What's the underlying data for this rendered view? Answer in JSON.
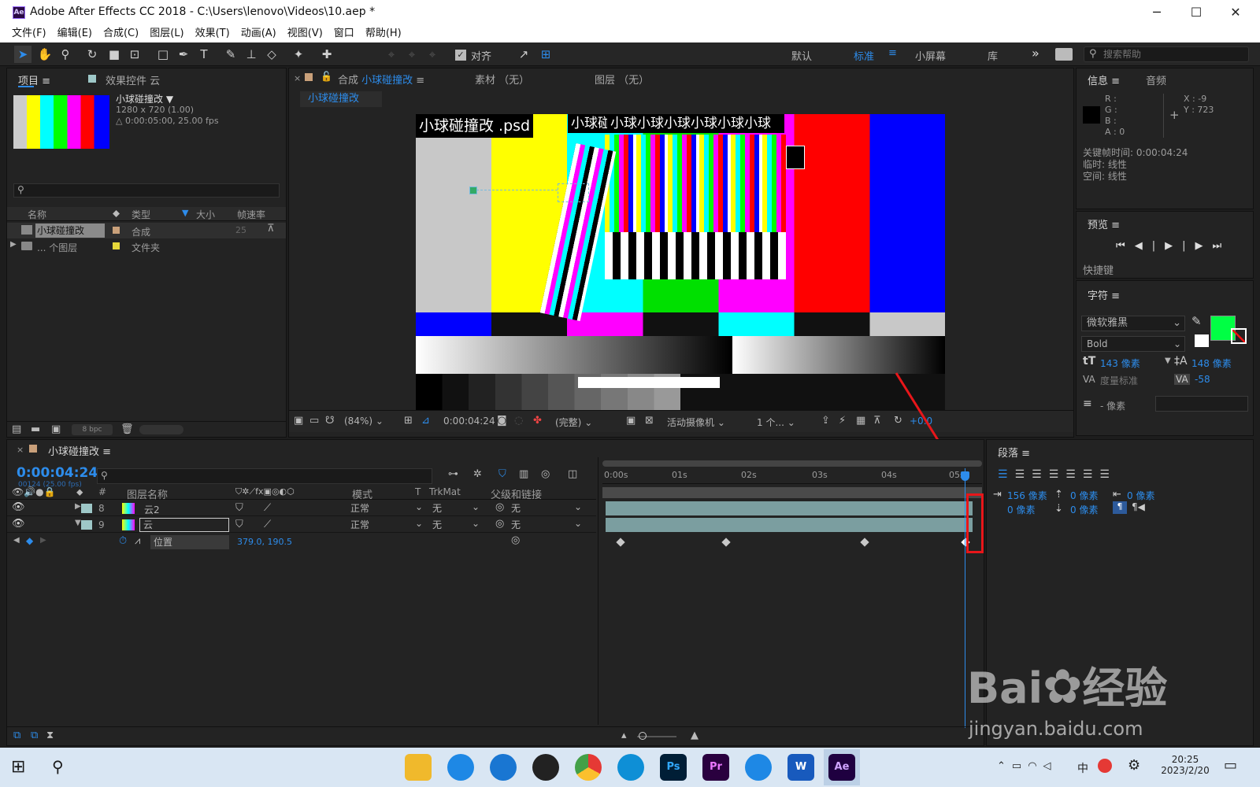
{
  "window": {
    "title": "Adobe After Effects CC 2018 - C:\\Users\\lenovo\\Videos\\10.aep *",
    "logo": "Ae",
    "minimize": "─",
    "maximize": "☐",
    "close": "✕"
  },
  "menu": [
    "文件(F)",
    "编辑(E)",
    "合成(C)",
    "图层(L)",
    "效果(T)",
    "动画(A)",
    "视图(V)",
    "窗口",
    "帮助(H)"
  ],
  "toolbar": {
    "align_label": "对齐",
    "workspaces": [
      "默认",
      "标准",
      "小屏幕",
      "库"
    ],
    "active_workspace": "标准",
    "more": "»",
    "search_placeholder": "搜索帮助"
  },
  "project": {
    "tabs": [
      "项目",
      "效果控件 云"
    ],
    "item_name": "小球碰撞改 ▼",
    "item_res": "1280 x 720 (1.00)",
    "item_dur": "△ 0:00:05:00, 25.00 fps",
    "search_placeholder": "",
    "columns": [
      "名称",
      "类型",
      "大小",
      "帧速率"
    ],
    "rows": [
      {
        "name": "小球碰撞改",
        "type": "合成",
        "fps": "25"
      },
      {
        "name": "... 个图层",
        "type": "文件夹",
        "fps": ""
      }
    ],
    "bpc": "8 bpc"
  },
  "comp": {
    "tab_prefix": "合成",
    "tab_name": "小球碰撞改",
    "footage_tab": "素材 （无）",
    "layer_tab": "图层 （无）",
    "breadcrumb": "小球碰撞改",
    "overlay1": "小球碰撞改 .psd",
    "overlay2": "小球碰撞改",
    "banner": "小球小球小球小球小球小球",
    "zoom": "(84%)",
    "timecode": "0:00:04:24",
    "quality": "(完整)",
    "camera": "活动摄像机",
    "views": "1 个...",
    "exposure": "+0.0"
  },
  "info": {
    "tabs": [
      "信息",
      "音频"
    ],
    "r": "R :",
    "g": "G :",
    "b": "B :",
    "a": "A : 0",
    "x": "X : -9",
    "y": "Y : 723",
    "kf_time": "关键帧时间: 0:00:04:24",
    "temporal": "临时: 线性",
    "spatial": "空间: 线性"
  },
  "preview": {
    "title": "预览",
    "controls": [
      "⏮",
      "◀|",
      "▶",
      "|▶",
      "⏭"
    ],
    "shortcut": "快捷键"
  },
  "character": {
    "title": "字符",
    "font": "微软雅黑",
    "style": "Bold",
    "size": "143 像素",
    "leading": "148 像素",
    "kerning": "度量标准",
    "tracking": "-58",
    "stroke": "- 像素",
    "fill_color": "#00ff44"
  },
  "paragraph": {
    "title": "段落",
    "indent_left": "156 像素",
    "indent_first": "0 像素",
    "space_before": "0 像素",
    "space_after": "0 像素",
    "indent_right": "0 像素"
  },
  "timeline": {
    "comp_name": "小球碰撞改",
    "timecode": "0:00:04:24",
    "frame_info": "00124 (25.00 fps)",
    "col_headers": {
      "num": "#",
      "name": "图层名称",
      "mode": "模式",
      "t": "T",
      "trkmat": "TrkMat",
      "parent": "父级和链接"
    },
    "layers": [
      {
        "num": "8",
        "name": "云2",
        "mode": "正常",
        "trkmat": "无",
        "parent": "无"
      },
      {
        "num": "9",
        "name": "云",
        "mode": "正常",
        "trkmat": "无",
        "parent": "无"
      }
    ],
    "prop_name": "位置",
    "prop_value": "379.0, 190.5",
    "ruler": [
      "0:00s",
      "01s",
      "02s",
      "03s",
      "04s",
      "05s"
    ]
  },
  "watermark": {
    "brand": "Bai",
    "cn": "经验",
    "url": "jingyan.baidu.com"
  },
  "taskbar": {
    "apps": [
      "Ps",
      "Pr",
      "W",
      "Ae"
    ],
    "ime": "中",
    "time": "20:25",
    "date": "2023/2/20"
  }
}
